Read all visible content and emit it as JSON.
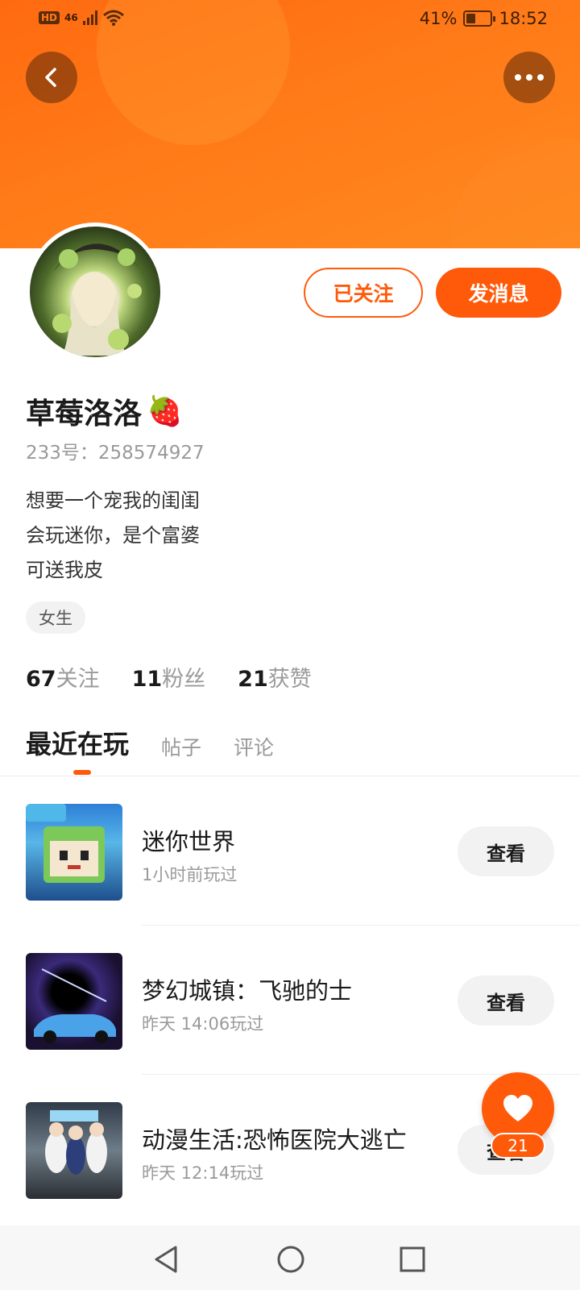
{
  "status_bar": {
    "network": "46",
    "hd_label": "HD",
    "battery_percent": "41%",
    "battery_level": 0.41,
    "time": "18:52"
  },
  "header": {
    "back_icon": "chevron-left-icon",
    "more_icon": "more-dots-icon"
  },
  "profile": {
    "username": "草莓洛洛",
    "username_emoji": "🍓",
    "uid": "233号：258574927",
    "bio_lines": [
      "想要一个宠我的闺闺",
      "会玩迷你，是个富婆",
      "可送我皮"
    ],
    "gender_tag": "女生",
    "follow_button": "已关注",
    "message_button": "发消息"
  },
  "stats": [
    {
      "count": "67",
      "label": "关注"
    },
    {
      "count": "11",
      "label": "粉丝"
    },
    {
      "count": "21",
      "label": "获赞"
    }
  ],
  "tabs": [
    {
      "label": "最近在玩",
      "active": true
    },
    {
      "label": "帖子",
      "active": false
    },
    {
      "label": "评论",
      "active": false
    }
  ],
  "games": [
    {
      "title": "迷你世界",
      "time": "1小时前玩过",
      "button": "查看"
    },
    {
      "title": "梦幻城镇：飞驰的士",
      "time": "昨天 14:06玩过",
      "button": "查看"
    },
    {
      "title": "动漫生活:恐怖医院大逃亡",
      "time": "昨天 12:14玩过",
      "button": "查看"
    }
  ],
  "like_fab": {
    "icon": "heart-icon",
    "count": "21"
  },
  "navbar": {
    "back_icon": "triangle-back-icon",
    "home_icon": "circle-home-icon",
    "recents_icon": "square-recents-icon"
  },
  "colors": {
    "accent": "#ff5a0a",
    "banner": "#ff7a18"
  }
}
